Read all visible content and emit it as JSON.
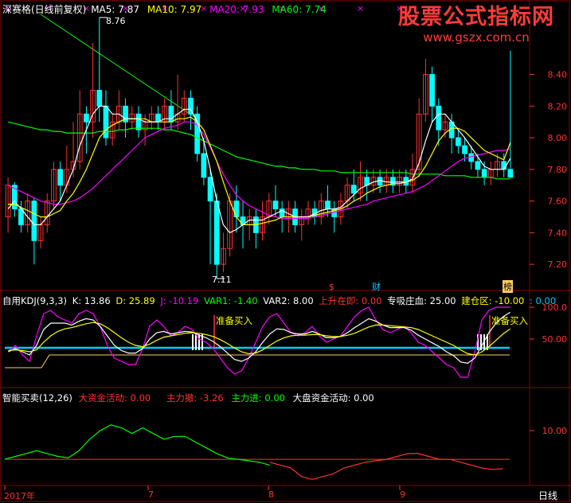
{
  "colors": {
    "up": "#ff3232",
    "down": "#00ffff",
    "ma5": "#ffffff",
    "ma10": "#ffff00",
    "ma20": "#ff00ff",
    "ma60": "#00ff00",
    "grid": "#8b0000",
    "axis": "#ff3232",
    "blue": "#00ccff"
  },
  "watermark": {
    "line1": "股票公式指标网",
    "line2": "www.gszx.com.cn"
  },
  "price_header": {
    "prefix": "深赛格(日线前复权)",
    "ma5": "MA5: 7.87",
    "ma10": "MA10: 7.97",
    "ma20": "MA20: 7.93",
    "ma60": "MA60: 7.74"
  },
  "kdj_header": {
    "name": "自用KDJ(9,3,3)",
    "k": "K: 13.86",
    "d": "D: 25.89",
    "j": "J: -10.19",
    "var1": "VAR1: -1.40",
    "var2": "VAR2: 8.00",
    "rise": "上升在即: 0.00",
    "absorb": "专吸庄血: 25.00",
    "build": "建仓区: -10.00",
    "extra": ": 0.00"
  },
  "smart_header": {
    "name": "智能买卖(12,26)",
    "big": "大资金活动: 0.00",
    "out": "主力撤: -3.26",
    "in": "主力进: 0.00",
    "market": "大盘资金活动: 0.00"
  },
  "markers": {
    "m1": "$",
    "m2": "财",
    "m3": "榜"
  },
  "kdj_signals": {
    "buy1": "准备买入",
    "buy2": "准备买入"
  },
  "x_axis": {
    "labels": [
      "2017年",
      "7",
      "8",
      "9"
    ],
    "period": "日线"
  },
  "chart_data": [
    {
      "type": "candlestick",
      "ylim": [
        7.1,
        8.76
      ],
      "yticks": [
        "8.40",
        "8.20",
        "8.00",
        "7.80",
        "7.60",
        "7.40",
        "7.20"
      ],
      "annotations": {
        "high": "8.76",
        "low": "7.11"
      },
      "candles": [
        [
          7.5,
          7.7,
          7.75,
          7.4
        ],
        [
          7.7,
          7.55,
          7.72,
          7.5
        ],
        [
          7.55,
          7.45,
          7.6,
          7.4
        ],
        [
          7.45,
          7.6,
          7.65,
          7.4
        ],
        [
          7.6,
          7.35,
          7.62,
          7.2
        ],
        [
          7.35,
          7.45,
          7.5,
          7.3
        ],
        [
          7.45,
          7.6,
          7.65,
          7.4
        ],
        [
          7.6,
          7.8,
          7.85,
          7.55
        ],
        [
          7.8,
          7.7,
          7.85,
          7.6
        ],
        [
          7.7,
          7.8,
          7.95,
          7.65
        ],
        [
          7.8,
          7.85,
          8.1,
          7.75
        ],
        [
          7.85,
          8.15,
          8.3,
          7.8
        ],
        [
          8.15,
          8.1,
          8.2,
          7.9
        ],
        [
          8.1,
          8.3,
          8.6,
          8.0
        ],
        [
          8.3,
          8.2,
          8.76,
          8.1
        ],
        [
          8.2,
          8.0,
          8.3,
          7.95
        ],
        [
          8.0,
          8.1,
          8.15,
          7.95
        ],
        [
          8.1,
          8.2,
          8.3,
          8.05
        ],
        [
          8.2,
          8.1,
          8.25,
          8.0
        ],
        [
          8.1,
          8.15,
          8.2,
          8.05
        ],
        [
          8.15,
          8.05,
          8.2,
          8.0
        ],
        [
          8.05,
          8.1,
          8.15,
          7.95
        ],
        [
          8.1,
          8.15,
          8.2,
          8.05
        ],
        [
          8.15,
          8.1,
          8.2,
          8.05
        ],
        [
          8.1,
          8.2,
          8.25,
          8.05
        ],
        [
          8.2,
          8.1,
          8.3,
          8.05
        ],
        [
          8.1,
          8.15,
          8.4,
          8.05
        ],
        [
          8.15,
          8.25,
          8.3,
          8.1
        ],
        [
          8.25,
          8.15,
          8.3,
          8.05
        ],
        [
          8.15,
          7.9,
          8.2,
          7.85
        ],
        [
          7.9,
          7.75,
          8.0,
          7.7
        ],
        [
          7.75,
          7.6,
          7.8,
          7.2
        ],
        [
          7.6,
          7.2,
          7.65,
          7.11
        ],
        [
          7.2,
          7.3,
          7.4,
          7.15
        ],
        [
          7.3,
          7.6,
          7.65,
          7.25
        ],
        [
          7.6,
          7.5,
          7.7,
          7.4
        ],
        [
          7.5,
          7.45,
          7.6,
          7.3
        ],
        [
          7.45,
          7.5,
          7.55,
          7.35
        ],
        [
          7.5,
          7.4,
          7.55,
          7.3
        ],
        [
          7.4,
          7.5,
          7.6,
          7.35
        ],
        [
          7.5,
          7.6,
          7.65,
          7.45
        ],
        [
          7.6,
          7.55,
          7.7,
          7.5
        ],
        [
          7.55,
          7.5,
          7.6,
          7.4
        ],
        [
          7.5,
          7.55,
          7.6,
          7.4
        ],
        [
          7.55,
          7.45,
          7.6,
          7.4
        ],
        [
          7.45,
          7.5,
          7.55,
          7.35
        ],
        [
          7.5,
          7.55,
          7.6,
          7.45
        ],
        [
          7.55,
          7.5,
          7.6,
          7.45
        ],
        [
          7.5,
          7.6,
          7.65,
          7.45
        ],
        [
          7.6,
          7.55,
          7.7,
          7.5
        ],
        [
          7.55,
          7.5,
          7.6,
          7.4
        ],
        [
          7.5,
          7.6,
          7.65,
          7.45
        ],
        [
          7.6,
          7.7,
          7.75,
          7.55
        ],
        [
          7.7,
          7.65,
          7.8,
          7.6
        ],
        [
          7.65,
          7.75,
          7.85,
          7.6
        ],
        [
          7.75,
          7.7,
          7.8,
          7.6
        ],
        [
          7.7,
          7.75,
          7.8,
          7.65
        ],
        [
          7.75,
          7.7,
          7.8,
          7.65
        ],
        [
          7.7,
          7.75,
          7.8,
          7.65
        ],
        [
          7.75,
          7.7,
          7.8,
          7.65
        ],
        [
          7.7,
          7.75,
          7.8,
          7.65
        ],
        [
          7.75,
          7.7,
          7.8,
          7.65
        ],
        [
          7.7,
          7.8,
          7.9,
          7.65
        ],
        [
          7.8,
          8.15,
          8.25,
          7.75
        ],
        [
          8.15,
          8.4,
          8.5,
          8.1
        ],
        [
          8.4,
          8.2,
          8.45,
          8.1
        ],
        [
          8.2,
          8.05,
          8.25,
          7.95
        ],
        [
          8.05,
          8.1,
          8.15,
          8.0
        ],
        [
          8.1,
          8.0,
          8.15,
          7.9
        ],
        [
          8.0,
          7.95,
          8.05,
          7.9
        ],
        [
          7.95,
          7.9,
          8.0,
          7.85
        ],
        [
          7.9,
          7.85,
          7.95,
          7.8
        ],
        [
          7.85,
          7.8,
          7.9,
          7.75
        ],
        [
          7.8,
          7.75,
          7.85,
          7.7
        ],
        [
          7.75,
          7.8,
          7.85,
          7.7
        ],
        [
          7.8,
          7.85,
          7.9,
          7.75
        ],
        [
          7.85,
          7.8,
          7.9,
          7.75
        ],
        [
          7.8,
          7.75,
          8.55,
          7.75
        ]
      ],
      "ma5": [
        7.55,
        7.6,
        7.55,
        7.5,
        7.45,
        7.45,
        7.5,
        7.55,
        7.6,
        7.7,
        7.8,
        7.95,
        8.05,
        8.15,
        8.2,
        8.2,
        8.15,
        8.15,
        8.12,
        8.12,
        8.12,
        8.1,
        8.1,
        8.1,
        8.12,
        8.12,
        8.15,
        8.18,
        8.18,
        8.1,
        7.98,
        7.8,
        7.6,
        7.45,
        7.4,
        7.42,
        7.45,
        7.48,
        7.48,
        7.48,
        7.5,
        7.52,
        7.54,
        7.52,
        7.5,
        7.5,
        7.5,
        7.52,
        7.54,
        7.55,
        7.55,
        7.56,
        7.6,
        7.64,
        7.68,
        7.7,
        7.72,
        7.73,
        7.72,
        7.72,
        7.72,
        7.72,
        7.74,
        7.84,
        7.98,
        8.1,
        8.15,
        8.15,
        8.1,
        8.05,
        8.0,
        7.94,
        7.88,
        7.82,
        7.8,
        7.8,
        7.8,
        7.87
      ],
      "ma10": [
        7.58,
        7.58,
        7.56,
        7.54,
        7.52,
        7.5,
        7.5,
        7.52,
        7.54,
        7.6,
        7.65,
        7.72,
        7.8,
        7.9,
        8.0,
        8.05,
        8.08,
        8.1,
        8.12,
        8.12,
        8.12,
        8.12,
        8.1,
        8.1,
        8.1,
        8.1,
        8.12,
        8.12,
        8.13,
        8.1,
        8.05,
        7.95,
        7.85,
        7.72,
        7.6,
        7.5,
        7.45,
        7.45,
        7.45,
        7.46,
        7.47,
        7.48,
        7.5,
        7.5,
        7.5,
        7.5,
        7.5,
        7.51,
        7.52,
        7.53,
        7.54,
        7.55,
        7.57,
        7.6,
        7.62,
        7.65,
        7.67,
        7.69,
        7.7,
        7.71,
        7.71,
        7.72,
        7.73,
        7.76,
        7.82,
        7.9,
        7.98,
        8.03,
        8.06,
        8.06,
        8.04,
        8.0,
        7.96,
        7.92,
        7.9,
        7.88,
        7.86,
        7.97
      ],
      "ma20": [
        7.7,
        7.68,
        7.66,
        7.64,
        7.62,
        7.6,
        7.59,
        7.58,
        7.58,
        7.59,
        7.6,
        7.62,
        7.65,
        7.68,
        7.72,
        7.76,
        7.8,
        7.84,
        7.88,
        7.92,
        7.96,
        8.0,
        8.02,
        8.04,
        8.06,
        8.07,
        8.08,
        8.1,
        8.1,
        8.08,
        8.02,
        7.94,
        7.85,
        7.77,
        7.7,
        7.64,
        7.6,
        7.57,
        7.55,
        7.53,
        7.51,
        7.5,
        7.49,
        7.49,
        7.49,
        7.49,
        7.49,
        7.5,
        7.51,
        7.52,
        7.53,
        7.54,
        7.55,
        7.56,
        7.57,
        7.58,
        7.6,
        7.61,
        7.62,
        7.63,
        7.64,
        7.65,
        7.66,
        7.68,
        7.7,
        7.73,
        7.76,
        7.79,
        7.82,
        7.85,
        7.87,
        7.88,
        7.89,
        7.9,
        7.91,
        7.92,
        7.92,
        7.93
      ],
      "ma60": [
        8.1,
        8.09,
        8.08,
        8.07,
        8.06,
        8.05,
        8.05,
        8.04,
        8.04,
        8.03,
        8.03,
        8.03,
        8.03,
        8.03,
        8.04,
        8.04,
        8.04,
        8.05,
        8.05,
        8.06,
        8.06,
        8.06,
        8.06,
        8.06,
        8.05,
        8.05,
        8.04,
        8.03,
        8.02,
        8.0,
        7.98,
        7.96,
        7.94,
        7.92,
        7.9,
        7.88,
        7.87,
        7.86,
        7.85,
        7.84,
        7.83,
        7.82,
        7.82,
        7.81,
        7.81,
        7.8,
        7.8,
        7.8,
        7.79,
        7.79,
        7.79,
        7.78,
        7.78,
        7.78,
        7.78,
        7.78,
        7.78,
        7.78,
        7.78,
        7.78,
        7.78,
        7.78,
        7.77,
        7.77,
        7.77,
        7.77,
        7.77,
        7.76,
        7.76,
        7.76,
        7.76,
        7.75,
        7.75,
        7.75,
        7.75,
        7.74,
        7.74,
        7.74
      ]
    },
    {
      "type": "line",
      "ylim": [
        -20,
        110
      ],
      "yticks": [
        "100.0",
        "50.00"
      ],
      "series": [
        {
          "name": "J",
          "values": [
            30,
            40,
            25,
            15,
            55,
            90,
            95,
            85,
            80,
            75,
            90,
            95,
            90,
            70,
            40,
            20,
            15,
            10,
            10,
            35,
            70,
            80,
            70,
            55,
            60,
            70,
            65,
            50,
            45,
            35,
            20,
            5,
            -5,
            0,
            20,
            45,
            70,
            85,
            90,
            75,
            60,
            55,
            60,
            70,
            55,
            45,
            50,
            55,
            70,
            85,
            95,
            100,
            80,
            65,
            60,
            65,
            70,
            60,
            45,
            40,
            30,
            20,
            10,
            5,
            -10,
            -10,
            30,
            80,
            95,
            100,
            100,
            100
          ]
        },
        {
          "name": "K",
          "values": [
            30,
            35,
            30,
            25,
            40,
            65,
            75,
            75,
            75,
            72,
            78,
            82,
            80,
            70,
            55,
            40,
            32,
            28,
            28,
            35,
            50,
            60,
            62,
            58,
            60,
            62,
            61,
            56,
            52,
            46,
            38,
            28,
            18,
            15,
            20,
            30,
            45,
            58,
            66,
            65,
            60,
            58,
            58,
            62,
            58,
            52,
            52,
            54,
            60,
            68,
            75,
            82,
            78,
            72,
            68,
            68,
            68,
            64,
            56,
            50,
            44,
            38,
            30,
            24,
            14,
            12,
            20,
            40,
            60,
            75,
            85,
            92
          ]
        },
        {
          "name": "D",
          "values": [
            32,
            33,
            32,
            30,
            33,
            45,
            55,
            62,
            66,
            68,
            71,
            74,
            76,
            74,
            68,
            60,
            52,
            45,
            40,
            38,
            42,
            48,
            53,
            55,
            57,
            59,
            60,
            59,
            57,
            54,
            49,
            43,
            36,
            30,
            27,
            28,
            33,
            40,
            47,
            52,
            55,
            56,
            56,
            57,
            57,
            55,
            54,
            54,
            56,
            59,
            64,
            69,
            72,
            72,
            71,
            70,
            69,
            68,
            65,
            60,
            55,
            50,
            45,
            40,
            33,
            27,
            25,
            30,
            38,
            48,
            58,
            66
          ]
        }
      ]
    },
    {
      "type": "line",
      "ylim": [
        -8,
        20
      ],
      "yticks": [
        "10.00"
      ],
      "series": [
        {
          "name": "主力进",
          "values": [
            0,
            1,
            2,
            3,
            2,
            1,
            0.5,
            3,
            7,
            10,
            12,
            11,
            9,
            11,
            9,
            7,
            8,
            8,
            6,
            4,
            2,
            0.5,
            0,
            -0.5,
            -1,
            -2
          ]
        },
        {
          "name": "主力撤",
          "values": [
            -1,
            -2,
            -3,
            -6,
            -7,
            -6,
            -5,
            -3,
            -2,
            -1,
            -0.5,
            0,
            1,
            2,
            2,
            1,
            0,
            0,
            -1,
            -2,
            -3,
            -3.5,
            -3.26
          ]
        }
      ]
    }
  ]
}
